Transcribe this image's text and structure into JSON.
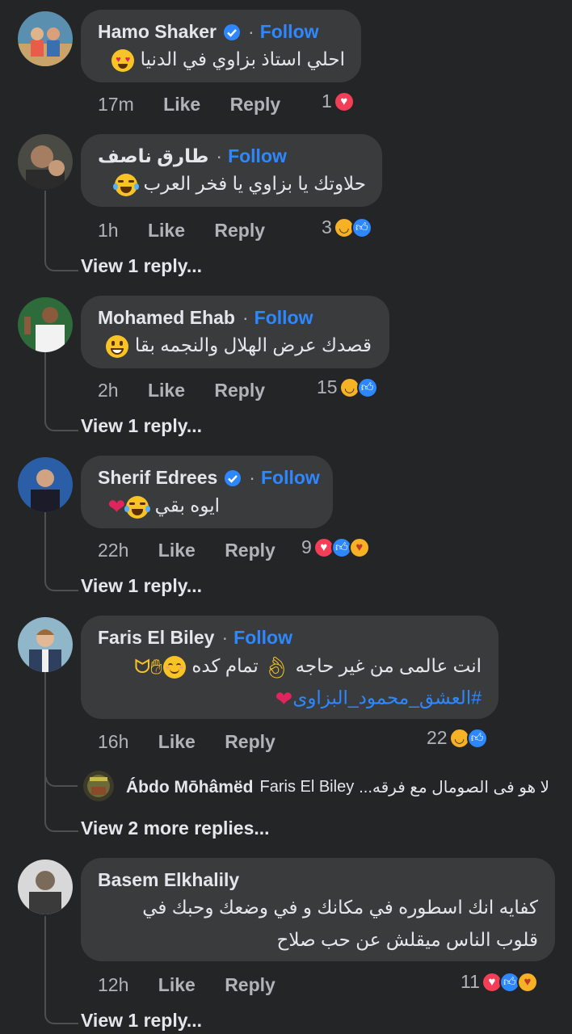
{
  "follow_label": "Follow",
  "like_label": "Like",
  "reply_label": "Reply",
  "colors": {
    "background": "#242526",
    "bubble": "#3a3b3c",
    "accent": "#2d88ff",
    "muted": "#b0b3b8"
  },
  "comments": [
    {
      "author": "Hamo Shaker",
      "verified": true,
      "text": "احلي استاذ بزاوي في الدنيا",
      "emoji": [
        "heart-eyes-emoji"
      ],
      "time": "17m",
      "reaction_count": "1",
      "reactions": [
        "love"
      ]
    },
    {
      "author": "طارق ناصف",
      "verified": false,
      "text": "حلاوتك يا بزاوي يا فخر العرب",
      "emoji": [
        "tears-of-joy-emoji"
      ],
      "time": "1h",
      "reaction_count": "3",
      "reactions": [
        "haha",
        "like"
      ],
      "view_replies": "View 1 reply..."
    },
    {
      "author": "Mohamed Ehab",
      "verified": false,
      "text": "قصدك عرض الهلال والنجمه بقا",
      "emoji": [
        "grinning-emoji"
      ],
      "time": "2h",
      "reaction_count": "15",
      "reactions": [
        "haha",
        "like"
      ],
      "view_replies": "View 1 reply..."
    },
    {
      "author": "Sherif Edrees",
      "verified": true,
      "text": "ايوه بقي",
      "emoji": [
        "tears-of-joy-emoji",
        "red-heart-emoji"
      ],
      "time": "22h",
      "reaction_count": "9",
      "reactions": [
        "love",
        "like",
        "care"
      ],
      "view_replies": "View 1 reply..."
    },
    {
      "author": "Faris El Biley",
      "verified": false,
      "text": "انت عالمى من غير حاجه",
      "text_2": "تمام كده",
      "hashtag": "#العشق_محمود_البزاوى",
      "emoji": [
        "ok-hand-emoji",
        "smiling-emoji",
        "clapping-hands-emoji",
        "heart-hands-emoji",
        "red-heart-emoji"
      ],
      "time": "16h",
      "reaction_count": "22",
      "reactions": [
        "haha",
        "like"
      ],
      "reply_preview": {
        "author": "Ábdo Mōhâmëd",
        "mention": "Faris El Biley",
        "text": "لا هو فى الصومال مع فرقه..."
      },
      "view_replies": "View 2 more replies..."
    },
    {
      "author": "Basem Elkhalily",
      "verified": false,
      "text_line1": "كفايه انك اسطوره في مكانك و في وضعك وحبك في",
      "text_line2": "قلوب الناس ميقلش عن حب صلاح",
      "time": "12h",
      "reaction_count": "11",
      "reactions": [
        "love",
        "like",
        "care"
      ],
      "view_replies": "View 1 reply..."
    }
  ]
}
